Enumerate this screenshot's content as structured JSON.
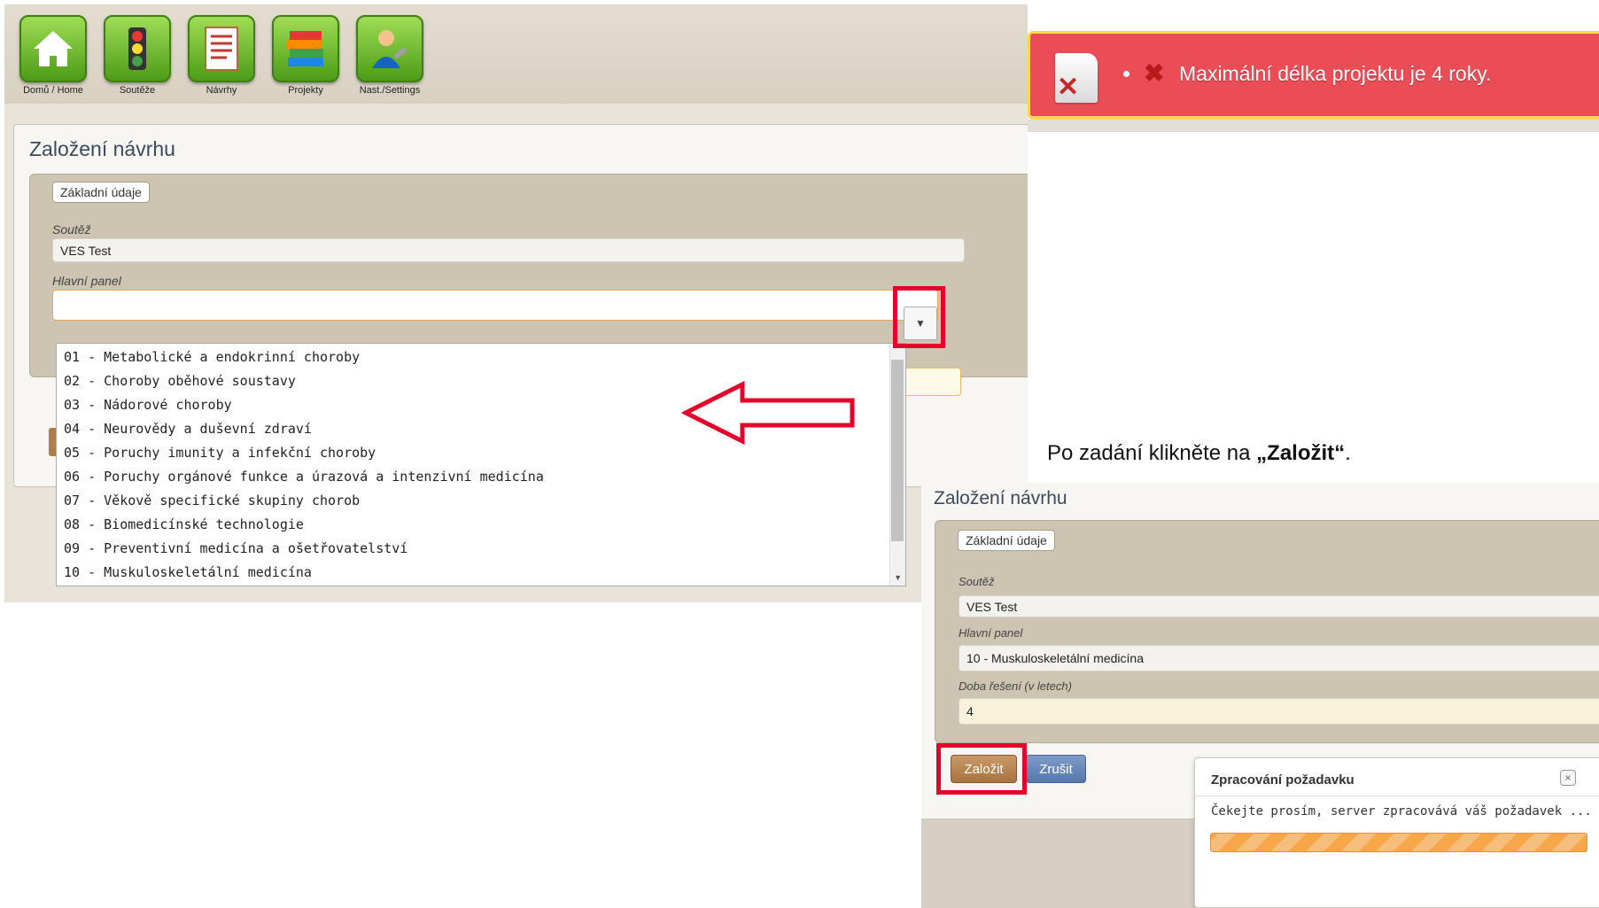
{
  "toolbar": {
    "items": [
      {
        "label": "Domů / Home",
        "icon": "home-icon"
      },
      {
        "label": "Soutěže",
        "icon": "traffic-light-icon"
      },
      {
        "label": "Návrhy",
        "icon": "document-icon"
      },
      {
        "label": "Projekty",
        "icon": "books-icon"
      },
      {
        "label": "Nast./Settings",
        "icon": "user-settings-icon"
      }
    ]
  },
  "form1": {
    "title": "Založení návrhu",
    "legend": "Základní údaje",
    "competition_label": "Soutěž",
    "competition_value": "VES Test",
    "panel_label": "Hlavní panel",
    "panel_value": ""
  },
  "dropdown": {
    "options": [
      "01 - Metabolické a endokrinní choroby",
      "02 - Choroby oběhové soustavy",
      "03 - Nádorové choroby",
      "04 - Neurovědy a duševní zdraví",
      "05 - Poruchy imunity a infekční choroby",
      "06 - Poruchy orgánové funkce a úrazová a intenzivní medicína",
      "07 - Věkově specifické skupiny chorob",
      "08 - Biomedicínské technologie",
      "09 - Preventivní medicína a ošetřovatelství",
      "10 - Muskuloskeletální medicína"
    ]
  },
  "error": {
    "message": "Maximální délka projektu je 4 roky."
  },
  "instruction": {
    "text": "Po zadání klikněte na ",
    "bold": "„Založit“",
    "end": "."
  },
  "form2": {
    "title": "Založení návrhu",
    "legend": "Základní údaje",
    "competition_label": "Soutěž",
    "competition_value": "VES Test",
    "panel_label": "Hlavní panel",
    "panel_value": "10 - Muskuloskeletální medicína",
    "duration_label": "Doba řešení (v letech)",
    "duration_value": "4",
    "submit_label": "Založit",
    "cancel_label": "Zrušit"
  },
  "dialog": {
    "title": "Zpracování požadavku",
    "close": "×",
    "message": "Čekejte prosím, server zpracovává váš požadavek ...",
    "progress_percent": 100
  },
  "colors": {
    "error_bg": "#ea4d56",
    "annotation_red": "#e4002b",
    "submit_brown": "#a8733e",
    "cancel_blue": "#5677ad"
  }
}
